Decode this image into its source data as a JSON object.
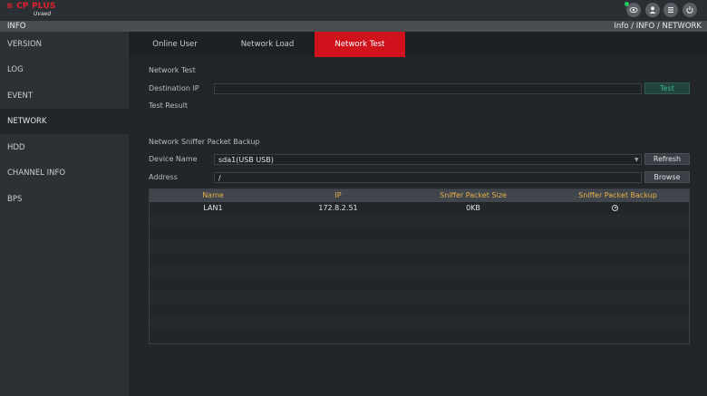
{
  "topbar": {
    "logo_main": "≅ CP PLUS",
    "logo_sub": "Uvaed",
    "icons": [
      "eye-icon",
      "user-icon",
      "menu-icon",
      "power-icon"
    ]
  },
  "infobar": {
    "title": "INFO",
    "breadcrumb": "Info  /  INFO  /  NETWORK"
  },
  "sidebar": {
    "items": [
      {
        "label": "VERSION"
      },
      {
        "label": "LOG"
      },
      {
        "label": "EVENT"
      },
      {
        "label": "NETWORK"
      },
      {
        "label": "HDD"
      },
      {
        "label": "CHANNEL INFO"
      },
      {
        "label": "BPS"
      }
    ],
    "active_index": 3
  },
  "tabs": [
    {
      "label": "Online User"
    },
    {
      "label": "Network Load"
    },
    {
      "label": "Network Test"
    }
  ],
  "network_test": {
    "section_title": "Network Test",
    "destination_label": "Destination IP",
    "destination_value": "",
    "test_button": "Test",
    "result_label": "Test Result"
  },
  "sniffer": {
    "section_title": "Network Sniffer Packet Backup",
    "device_label": "Device Name",
    "device_value": "sda1(USB USB)",
    "refresh_button": "Refresh",
    "address_label": "Address",
    "address_value": "/",
    "browse_button": "Browse"
  },
  "table": {
    "headers": [
      "Name",
      "IP",
      "Sniffer Packet Size",
      "Sniffer Packet Backup"
    ],
    "rows": [
      {
        "name": "LAN1",
        "ip": "172.8.2.51",
        "size": "0KB"
      }
    ]
  },
  "colors": {
    "accent_red": "#d0121c",
    "header_gold": "#e7b04a",
    "test_green": "#35b88c",
    "status_green": "#1bd05a"
  }
}
